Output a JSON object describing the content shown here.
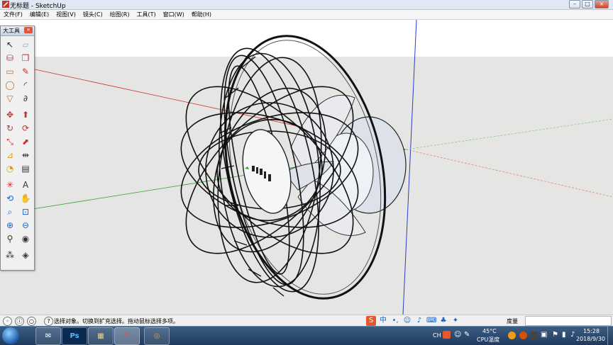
{
  "window": {
    "title": "无标题 - SketchUp",
    "minimize": "–",
    "maximize": "□",
    "close": "×"
  },
  "menu": [
    "文件(F)",
    "编辑(E)",
    "视图(V)",
    "镜头(C)",
    "绘图(R)",
    "工具(T)",
    "窗口(W)",
    "帮助(H)"
  ],
  "toolbar": {
    "title": "大工具",
    "close": "×",
    "tools": [
      {
        "name": "select-icon",
        "glyph": "↖"
      },
      {
        "name": "eraser-icon",
        "glyph": "▱"
      },
      {
        "name": "paint-bucket-icon",
        "glyph": "⛁"
      },
      {
        "name": "make-component-icon",
        "glyph": "❒"
      },
      {
        "name": "rectangle-icon",
        "glyph": "▭"
      },
      {
        "name": "pencil-icon",
        "glyph": "✎"
      },
      {
        "name": "circle-icon",
        "glyph": "◯"
      },
      {
        "name": "arc-icon",
        "glyph": "◜"
      },
      {
        "name": "polygon-icon",
        "glyph": "▽"
      },
      {
        "name": "freehand-icon",
        "glyph": "∂"
      },
      {
        "name": "move-icon",
        "glyph": "✥"
      },
      {
        "name": "push-pull-icon",
        "glyph": "⬆"
      },
      {
        "name": "rotate-icon",
        "glyph": "↻"
      },
      {
        "name": "follow-me-icon",
        "glyph": "⟳"
      },
      {
        "name": "scale-icon",
        "glyph": "⤡"
      },
      {
        "name": "offset-icon",
        "glyph": "⬈"
      },
      {
        "name": "tape-measure-icon",
        "glyph": "⊿"
      },
      {
        "name": "dimension-icon",
        "glyph": "⇹"
      },
      {
        "name": "protractor-icon",
        "glyph": "◔"
      },
      {
        "name": "text-icon",
        "glyph": "▤"
      },
      {
        "name": "axes-icon",
        "glyph": "✳"
      },
      {
        "name": "3d-text-icon",
        "glyph": "A"
      },
      {
        "name": "orbit-icon",
        "glyph": "⟲"
      },
      {
        "name": "pan-icon",
        "glyph": "✋"
      },
      {
        "name": "zoom-icon",
        "glyph": "⌕"
      },
      {
        "name": "zoom-window-icon",
        "glyph": "⊡"
      },
      {
        "name": "zoom-extents-icon",
        "glyph": "⊕"
      },
      {
        "name": "previous-view-icon",
        "glyph": "⊖"
      },
      {
        "name": "position-camera-icon",
        "glyph": "⚲"
      },
      {
        "name": "look-around-icon",
        "glyph": "◉"
      },
      {
        "name": "walk-icon",
        "glyph": "⁂"
      },
      {
        "name": "section-plane-icon",
        "glyph": "◈"
      }
    ]
  },
  "status": {
    "text": "选择对象。切换到扩充选择。拖动鼠标选择多项。",
    "measure_label": "度量"
  },
  "taskbar": {
    "apps": [
      {
        "name": "mail-icon",
        "glyph": "✉"
      },
      {
        "name": "photoshop-icon",
        "glyph": "Ps"
      },
      {
        "name": "explorer-icon",
        "glyph": "▦"
      },
      {
        "name": "sketchup-icon",
        "glyph": "✎"
      },
      {
        "name": "media-icon",
        "glyph": "◎"
      }
    ],
    "tray": {
      "lang": "CH",
      "temp": "45°C",
      "temp_label": "CPU温度",
      "time": "15:28",
      "date": "2018/9/30"
    }
  }
}
